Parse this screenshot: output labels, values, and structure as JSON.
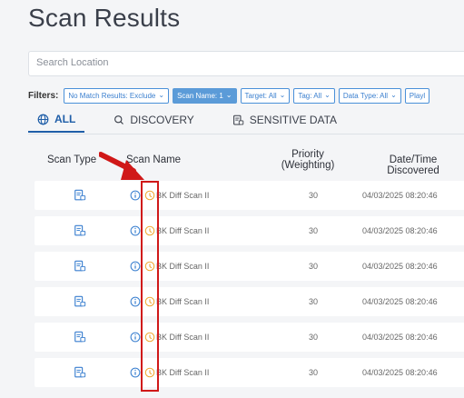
{
  "page": {
    "title": "Scan Results"
  },
  "search": {
    "placeholder": "Search Location"
  },
  "filters": {
    "label": "Filters:",
    "chips": [
      {
        "label": "No Match Results: Exclude",
        "active": false
      },
      {
        "label": "Scan Name: 1",
        "active": true
      },
      {
        "label": "Target: All",
        "active": false
      },
      {
        "label": "Tag: All",
        "active": false
      },
      {
        "label": "Data Type: All",
        "active": false
      },
      {
        "label": "Playl",
        "active": false
      }
    ]
  },
  "tabs": [
    {
      "label": "ALL",
      "icon": "globe-icon",
      "active": true
    },
    {
      "label": "DISCOVERY",
      "icon": "search-icon",
      "active": false
    },
    {
      "label": "SENSITIVE DATA",
      "icon": "sensitive-data-icon",
      "active": false
    }
  ],
  "table": {
    "headers": {
      "scan_type": "Scan Type",
      "scan_name": "Scan Name",
      "priority_line1": "Priority",
      "priority_line2": "(Weighting)",
      "date": "Date/Time Discovered"
    },
    "rows": [
      {
        "scan_name": "BK Diff Scan II",
        "priority": "30",
        "date": "04/03/2025 08:20:46"
      },
      {
        "scan_name": "BK Diff Scan II",
        "priority": "30",
        "date": "04/03/2025 08:20:46"
      },
      {
        "scan_name": "BK Diff Scan II",
        "priority": "30",
        "date": "04/03/2025 08:20:46"
      },
      {
        "scan_name": "BK Diff Scan II",
        "priority": "30",
        "date": "04/03/2025 08:20:46"
      },
      {
        "scan_name": "BK Diff Scan II",
        "priority": "30",
        "date": "04/03/2025 08:20:46"
      },
      {
        "scan_name": "BK Diff Scan II",
        "priority": "30",
        "date": "04/03/2025 08:20:46"
      }
    ]
  },
  "colors": {
    "accent": "#1f5ea8",
    "chip_border": "#4a90d9",
    "active_chip": "#5b9bd8",
    "warning": "#f0a830",
    "annotation": "#d01818"
  }
}
